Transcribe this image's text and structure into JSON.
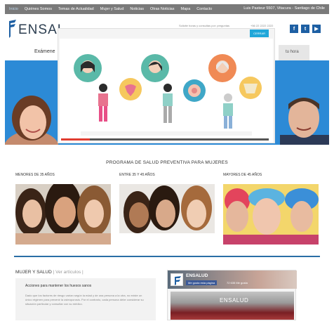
{
  "topnav": {
    "items": [
      "Inicio",
      "Quiénes Somos",
      "Temas de Actualidad",
      "Mujer y Salud",
      "Noticias",
      "Otras Noticias",
      "Mapa",
      "Contacto"
    ],
    "address": "Luis Pasteur 5507, Vitacura - Santiago de Chile"
  },
  "header": {
    "logo_text": "ENSAL",
    "small_text_1": "Solicite horas y consultas por: preguntas",
    "small_text_2": "+56 22 2222 2222"
  },
  "subnav": {
    "left_item": "Exámene",
    "right_item": "tu hora"
  },
  "popup": {
    "close_label": "CERRAR",
    "progress": 0.14
  },
  "program": {
    "title": "PROGRAMA DE SALUD PREVENTIVA PARA MUJERES",
    "columns": [
      {
        "label": "MENORES DE 35 AÑOS"
      },
      {
        "label": "ENTRE 35 Y 45 AÑOS"
      },
      {
        "label": "MAYORES DE 45 AÑOS"
      }
    ]
  },
  "mujer": {
    "title": "MUJER Y SALUD",
    "link": "| Ver artículos |",
    "article_title": "Acciones para mantener los huesos sanos",
    "article_body": "Dado que los factores de riesgo varían según la edad y de una persona a la otra, no existe un único régimen para prevenir la osteoporosis. Por el contrario, cada persona debe considerar su situación particular y consultar con su médico."
  },
  "facebook": {
    "name": "ENSALUD",
    "like_label": "Me gusta esta página",
    "count": "72 635 Me gusta",
    "banner_text": "ENSALUD"
  },
  "colors": {
    "topnav_bg": "#7a7a7a",
    "brand_blue": "#1d5fa3",
    "hero_blue": "#2c8ad6",
    "close_button": "#21a7d9"
  }
}
